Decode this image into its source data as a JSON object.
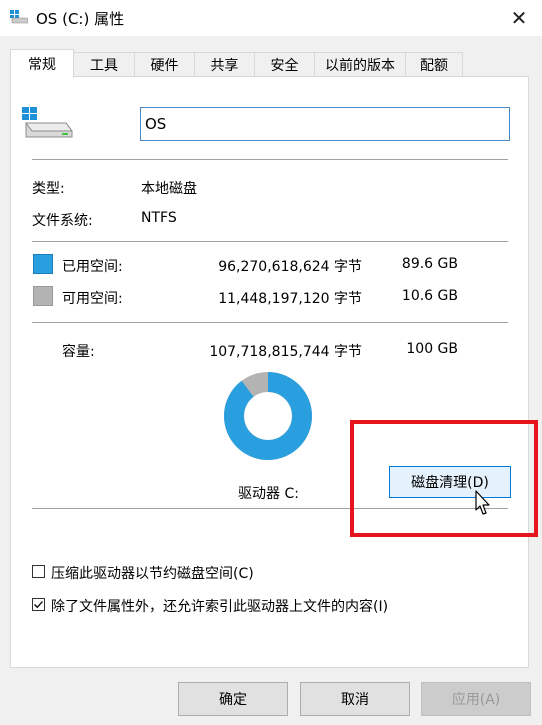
{
  "window": {
    "title": "OS (C:) 属性",
    "close": "✕"
  },
  "tabs": [
    "常规",
    "工具",
    "硬件",
    "共享",
    "安全",
    "以前的版本",
    "配额"
  ],
  "general": {
    "name_value": "OS",
    "type_label": "类型:",
    "type_value": "本地磁盘",
    "fs_label": "文件系统:",
    "fs_value": "NTFS",
    "used_label": "已用空间:",
    "used_bytes": "96,270,618,624 字节",
    "used_size": "89.6 GB",
    "free_label": "可用空间:",
    "free_bytes": "11,448,197,120 字节",
    "free_size": "10.6 GB",
    "capacity_label": "容量:",
    "capacity_bytes": "107,718,815,744 字节",
    "capacity_size": "100 GB",
    "drive_label": "驱动器 C:",
    "cleanup_button": "磁盘清理(D)",
    "used_fraction": 0.896,
    "compress_label": "压缩此驱动器以节约磁盘空间(C)",
    "compress_checked": false,
    "index_label": "除了文件属性外，还允许索引此驱动器上文件的内容(I)",
    "index_checked": true
  },
  "colors": {
    "used": "#2a9fe0",
    "free": "#b3b3b3",
    "highlight": "#e8141b"
  },
  "buttons": {
    "ok": "确定",
    "cancel": "取消",
    "apply": "应用(A)"
  }
}
